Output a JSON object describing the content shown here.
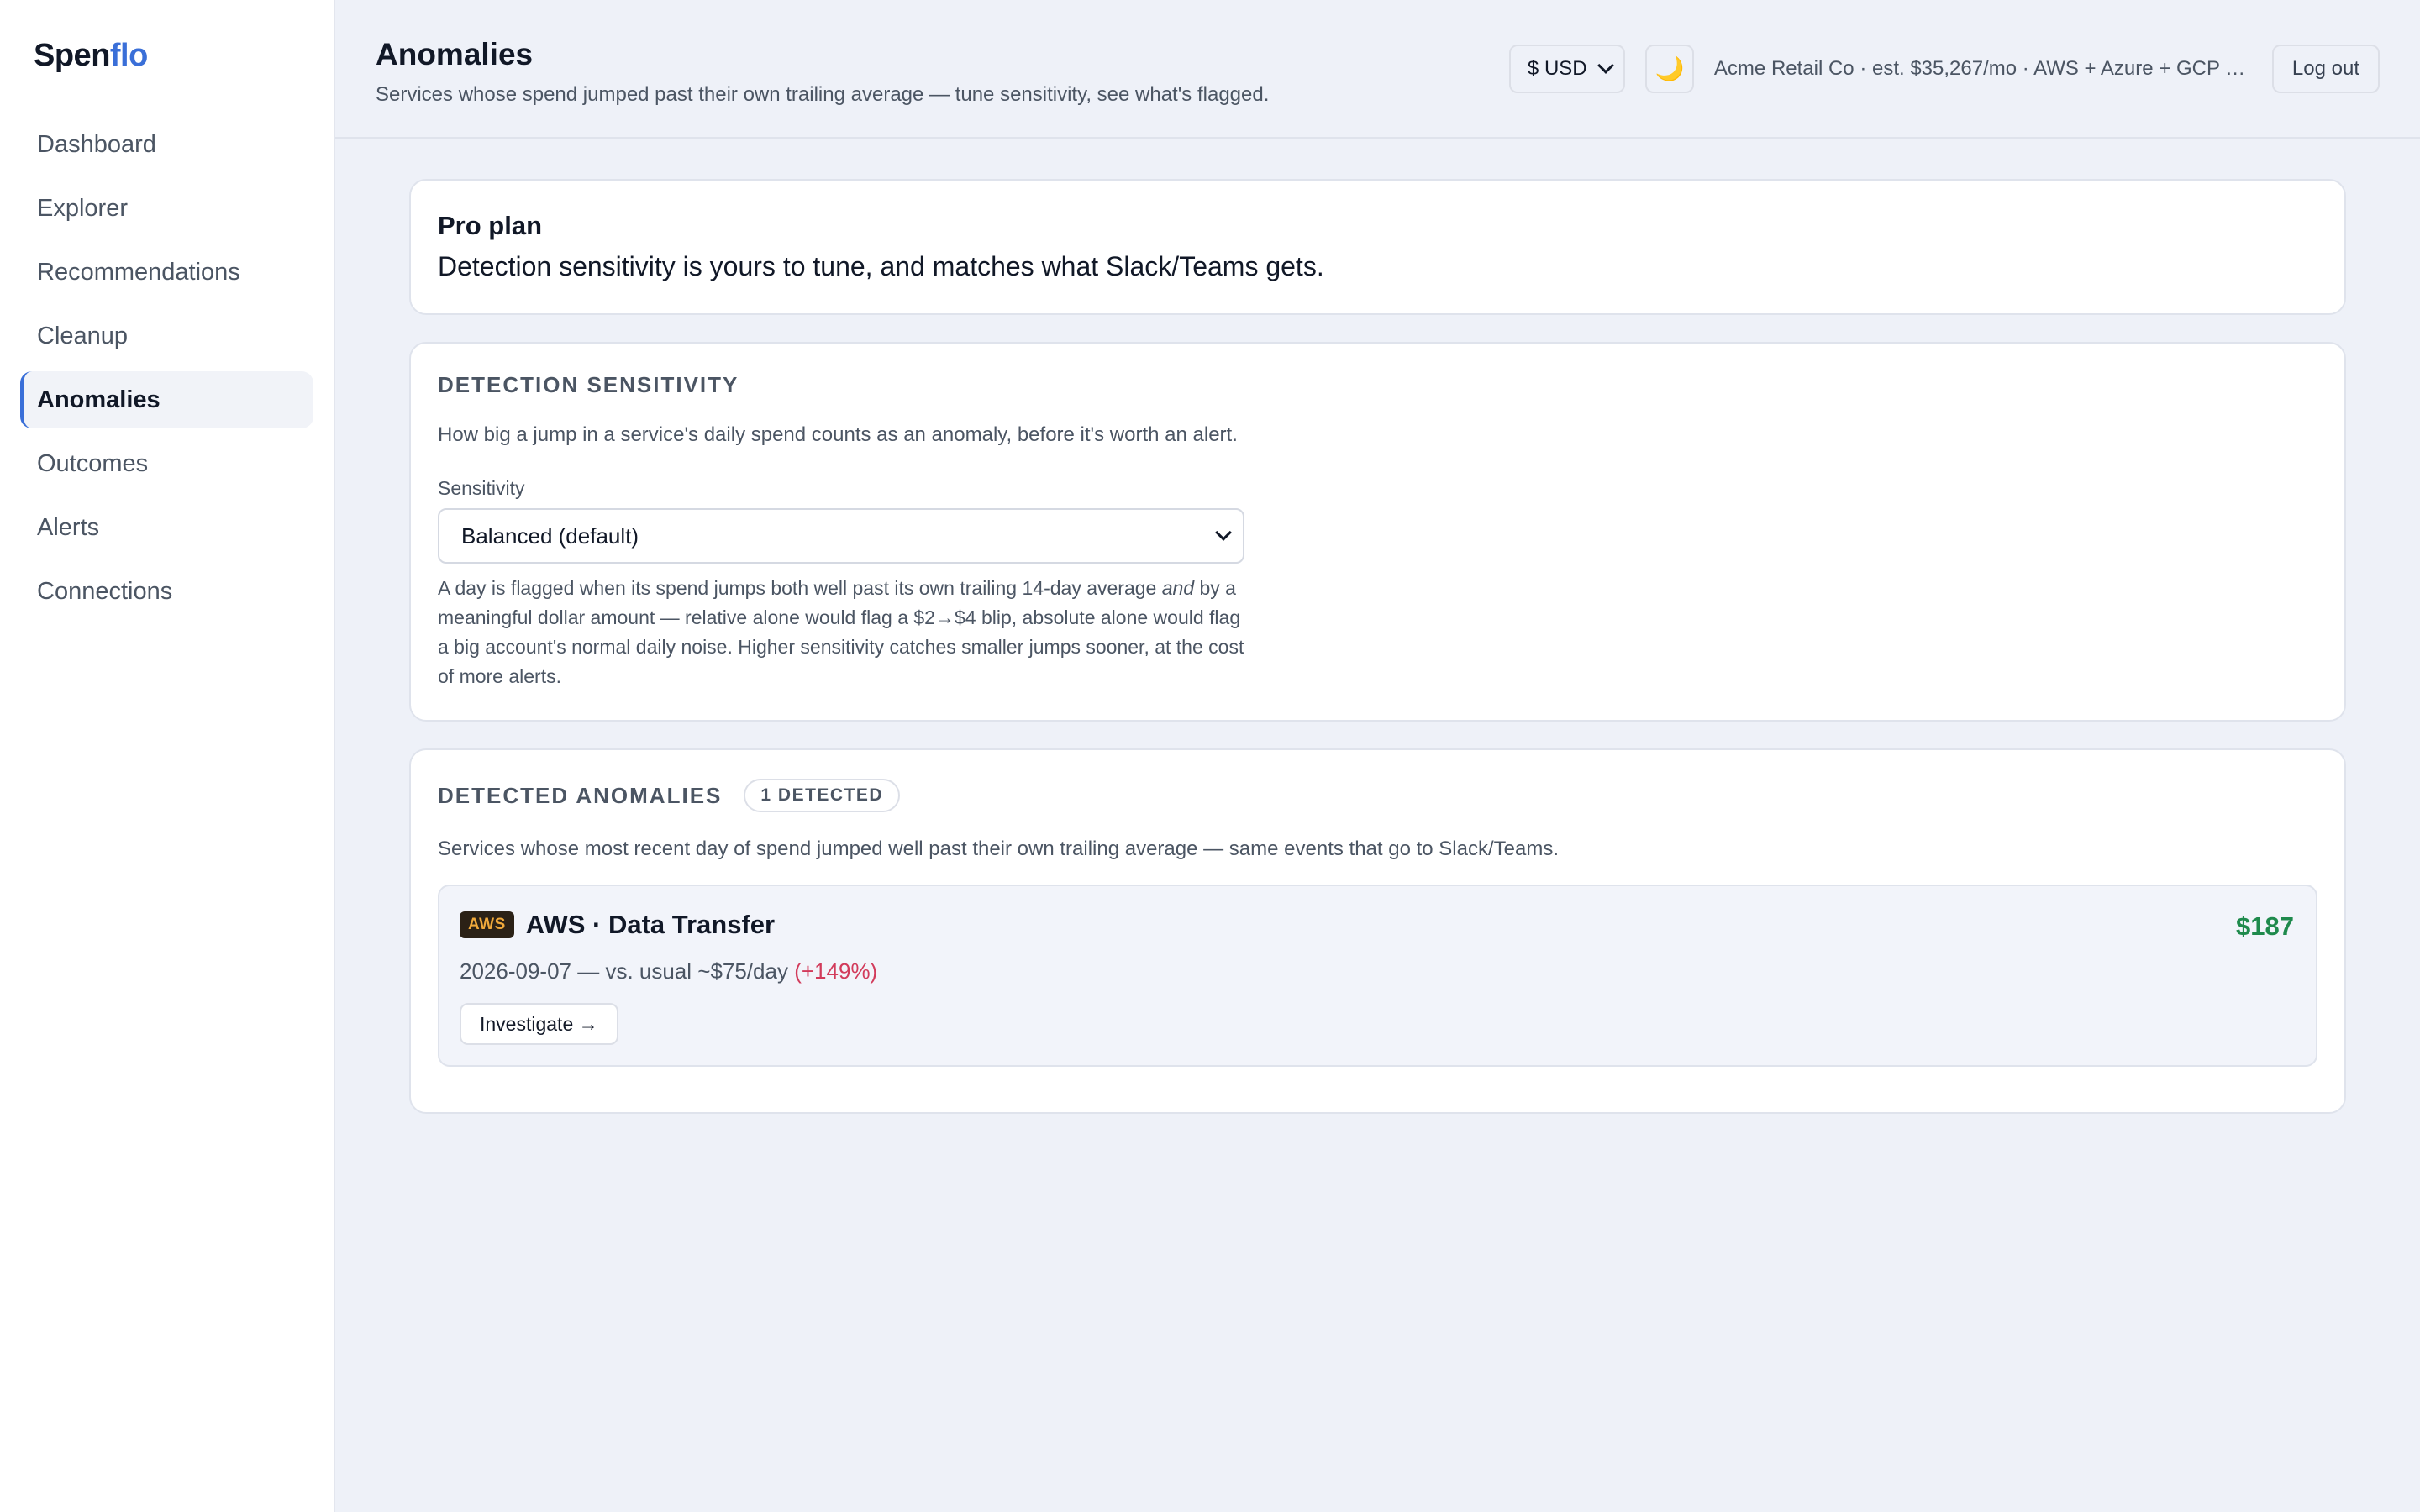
{
  "brand": {
    "part1": "Spen",
    "part2": "flo"
  },
  "sidebar": {
    "items": [
      {
        "label": "Dashboard"
      },
      {
        "label": "Explorer"
      },
      {
        "label": "Recommendations"
      },
      {
        "label": "Cleanup"
      },
      {
        "label": "Anomalies",
        "active": true
      },
      {
        "label": "Outcomes"
      },
      {
        "label": "Alerts"
      },
      {
        "label": "Connections"
      }
    ]
  },
  "header": {
    "title": "Anomalies",
    "subtitle": "Services whose spend jumped past their own trailing average — tune sensitivity, see what's flagged.",
    "currency": "$ USD",
    "theme_icon": "🌙",
    "account": "Acme Retail Co · est. $35,267/mo · AWS + Azure + GCP …",
    "logout": "Log out"
  },
  "plan": {
    "title": "Pro plan",
    "description": "Detection sensitivity is yours to tune, and matches what Slack/Teams gets."
  },
  "sensitivity": {
    "heading": "Detection sensitivity",
    "description": "How big a jump in a service's daily spend counts as an anomaly, before it's worth an alert.",
    "label": "Sensitivity",
    "selected": "Balanced (default)",
    "help_before": "A day is flagged when its spend jumps both well past its own trailing 14-day average ",
    "help_em": "and",
    "help_after": " by a meaningful dollar amount — relative alone would flag a $2→$4 blip, absolute alone would flag a big account's normal daily noise. Higher sensitivity catches smaller jumps sooner, at the cost of more alerts."
  },
  "anomalies": {
    "heading": "Detected anomalies",
    "badge": "1 detected",
    "description": "Services whose most recent day of spend jumped well past their own trailing average — same events that go to Slack/Teams.",
    "items": [
      {
        "provider": "AWS",
        "title": "AWS · Data Transfer",
        "amount": "$187",
        "meta": "2026-09-07 — vs. usual ~$75/day",
        "pct": "(+149%)",
        "action": "Investigate →"
      }
    ]
  },
  "colors": {
    "accent": "#3a6fd8",
    "positive": "#1f8a4c",
    "negative": "#d23b5b",
    "aws_chip_bg": "#2b2116",
    "aws_chip_fg": "#f0a93b"
  }
}
